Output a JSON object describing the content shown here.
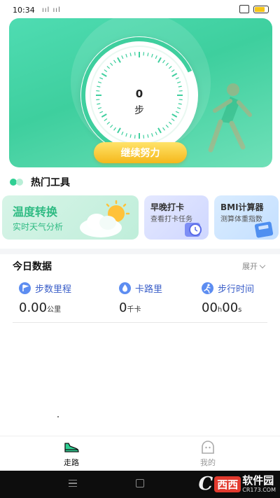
{
  "status_bar": {
    "time": "10:34",
    "signal_text": "ııl ııl",
    "battery_level_pct": 80,
    "battery_color": "#f5c518"
  },
  "hero": {
    "steps_count": "0",
    "steps_unit": "步",
    "cta_label": "继续努力",
    "accent": "#3ecf9e"
  },
  "hot_tools": {
    "title": "热门工具",
    "cards": [
      {
        "title": "温度转换",
        "subtitle": "实时天气分析",
        "icon": "weather-icon"
      },
      {
        "title": "早晚打卡",
        "subtitle": "查看打卡任务",
        "icon": "alarm-clock-icon"
      },
      {
        "title": "BMI计算器",
        "subtitle": "测算体重指数",
        "icon": "bmi-icon"
      }
    ]
  },
  "today": {
    "title": "今日数据",
    "expand_label": "展开",
    "stats": [
      {
        "label": "步数里程",
        "value": "0.00",
        "unit": "公里",
        "icon": "flag-icon"
      },
      {
        "label": "卡路里",
        "value": "0",
        "unit": "千卡",
        "icon": "flame-icon"
      },
      {
        "label": "步行时间",
        "value": "00",
        "unit": "h",
        "value2": "00",
        "unit2": "s",
        "icon": "runner-icon"
      }
    ]
  },
  "tabbar": {
    "tabs": [
      {
        "label": "走路",
        "icon": "shoe-icon",
        "active": true
      },
      {
        "label": "我的",
        "icon": "profile-icon",
        "active": false
      }
    ]
  },
  "watermark": {
    "badge": "西西",
    "main": "软件园",
    "url": "CR173.COM"
  }
}
